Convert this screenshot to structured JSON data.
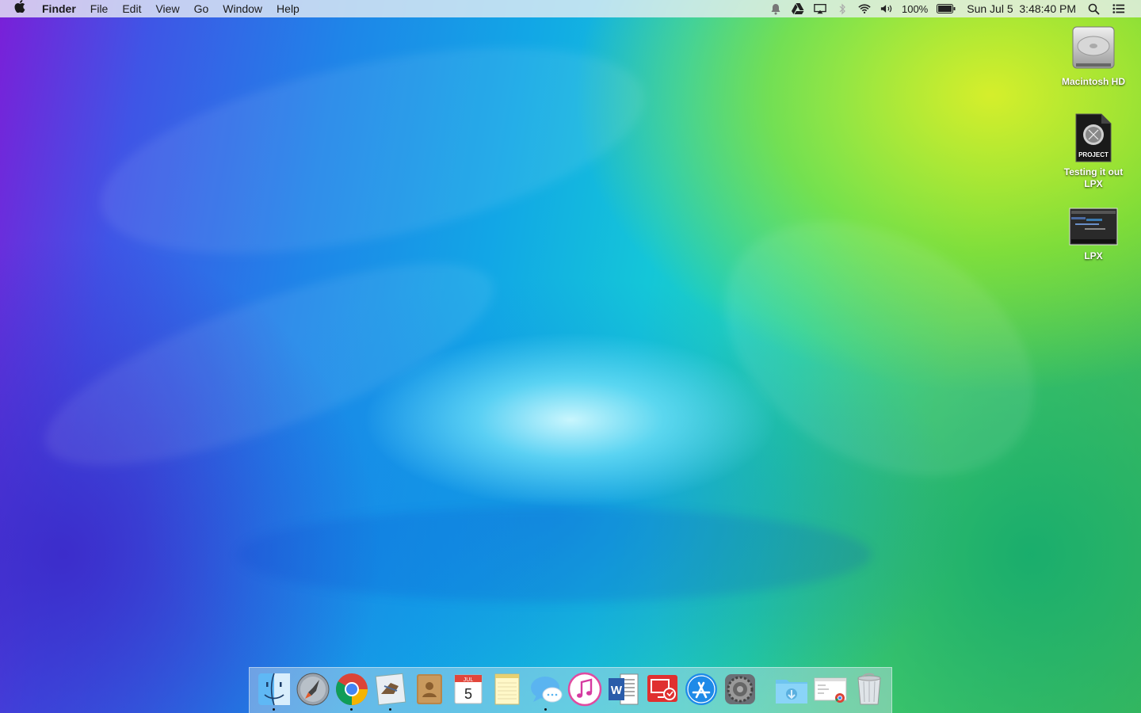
{
  "menubar": {
    "apple_glyph": "",
    "app_name": "Finder",
    "menus": [
      "File",
      "Edit",
      "View",
      "Go",
      "Window",
      "Help"
    ],
    "status_icons": [
      "notification-bell-icon",
      "google-drive-icon",
      "airplay-icon",
      "bluetooth-icon",
      "wifi-icon",
      "volume-icon"
    ],
    "battery_percent": "100%",
    "battery_icon": "battery-icon",
    "date": "Sun Jul 5",
    "time": "3:48:40 PM",
    "right_icons": [
      "spotlight-search-icon",
      "notification-center-icon"
    ]
  },
  "desktop": {
    "icons": [
      {
        "label": "Macintosh HD",
        "icon": "hard-drive-icon"
      },
      {
        "label": "Testing it out LPX",
        "icon": "logic-project-icon",
        "badge": "PROJECT"
      },
      {
        "label": "LPX",
        "icon": "screenshot-thumbnail-icon"
      }
    ]
  },
  "dock": {
    "apps": [
      {
        "name": "Finder",
        "icon": "finder-icon",
        "running": true
      },
      {
        "name": "Launchpad",
        "icon": "launchpad-icon",
        "running": false
      },
      {
        "name": "Google Chrome",
        "icon": "chrome-icon",
        "running": true
      },
      {
        "name": "Mail",
        "icon": "mail-icon",
        "running": true
      },
      {
        "name": "Contacts",
        "icon": "contacts-icon",
        "running": false
      },
      {
        "name": "Calendar",
        "icon": "calendar-icon",
        "running": false,
        "month": "JUL",
        "day": "5"
      },
      {
        "name": "Notes",
        "icon": "notes-icon",
        "running": false
      },
      {
        "name": "Messages",
        "icon": "messages-icon",
        "running": true
      },
      {
        "name": "iTunes",
        "icon": "itunes-icon",
        "running": false
      },
      {
        "name": "Microsoft Word",
        "icon": "word-icon",
        "running": false,
        "letter": "W"
      },
      {
        "name": "Remote Desktop",
        "icon": "remote-desktop-icon",
        "running": false
      },
      {
        "name": "App Store",
        "icon": "app-store-icon",
        "running": false
      },
      {
        "name": "System Preferences",
        "icon": "system-preferences-icon",
        "running": false
      }
    ],
    "stacks": [
      {
        "name": "Downloads",
        "icon": "downloads-folder-icon"
      },
      {
        "name": "Document Stack",
        "icon": "document-stack-icon"
      },
      {
        "name": "Trash",
        "icon": "trash-icon"
      }
    ]
  }
}
